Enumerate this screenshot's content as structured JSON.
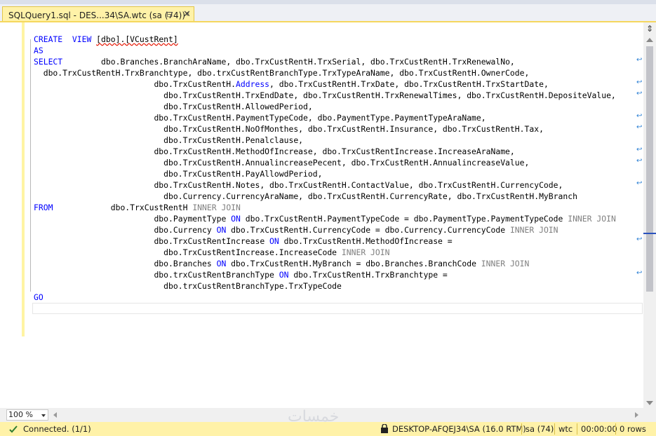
{
  "tab": {
    "title": "SQLQuery1.sql - DES...34\\SA.wtc (sa (74))*",
    "pin_icon": "pin-icon",
    "close_icon": "close-icon"
  },
  "editor": {
    "lines": [
      [
        "CREATE",
        "  VIEW ",
        "[dbo].[VCustRent]"
      ],
      [
        "AS"
      ],
      [
        "SELECT",
        "        dbo.Branches.BranchAraName, dbo.TrxCustRentH.TrxSerial, dbo.TrxCustRentH.TrxRenewalNo,"
      ],
      [
        "  dbo.TrxCustRentH.TrxBranchtype, dbo.trxCustRentBranchType.TrxTypeAraName, dbo.TrxCustRentH.OwnerCode,"
      ],
      [
        "                         dbo.TrxCustRentH.",
        "Address",
        ", dbo.TrxCustRentH.TrxDate, dbo.TrxCustRentH.TrxStartDate,"
      ],
      [
        "                           dbo.TrxCustRentH.TrxEndDate, dbo.TrxCustRentH.TrxRenewalTimes, dbo.TrxCustRentH.DepositeValue,"
      ],
      [
        "                           dbo.TrxCustRentH.AllowedPeriod,"
      ],
      [
        "                         dbo.TrxCustRentH.PaymentTypeCode, dbo.PaymentType.PaymentTypeAraName,"
      ],
      [
        "                           dbo.TrxCustRentH.NoOfMonthes, dbo.TrxCustRentH.Insurance, dbo.TrxCustRentH.Tax,"
      ],
      [
        "                           dbo.TrxCustRentH.Penalclause,"
      ],
      [
        "                         dbo.TrxCustRentH.MethodOfIncrease, dbo.TrxCustRentIncrease.IncreaseAraName,"
      ],
      [
        "                           dbo.TrxCustRentH.AnnualincreasePecent, dbo.TrxCustRentH.AnnualincreaseValue,"
      ],
      [
        "                           dbo.TrxCustRentH.PayAllowdPeriod,"
      ],
      [
        "                         dbo.TrxCustRentH.Notes, dbo.TrxCustRentH.ContactValue, dbo.TrxCustRentH.CurrencyCode,"
      ],
      [
        "                           dbo.Currency.CurrencyAraName, dbo.TrxCustRentH.CurrencyRate, dbo.TrxCustRentH.MyBranch"
      ],
      [
        "FROM",
        "            dbo.TrxCustRentH ",
        "INNER JOIN"
      ],
      [
        "                         dbo.PaymentType ",
        "ON",
        " dbo.TrxCustRentH.PaymentTypeCode = dbo.PaymentType.PaymentTypeCode ",
        "INNER JOIN"
      ],
      [
        "                         dbo.Currency ",
        "ON",
        " dbo.TrxCustRentH.CurrencyCode = dbo.Currency.CurrencyCode ",
        "INNER JOIN"
      ],
      [
        "                         dbo.TrxCustRentIncrease ",
        "ON",
        " dbo.TrxCustRentH.MethodOfIncrease ="
      ],
      [
        "                           dbo.TrxCustRentIncrease.IncreaseCode ",
        "INNER JOIN"
      ],
      [
        "                         dbo.Branches ",
        "ON",
        " dbo.TrxCustRentH.MyBranch = dbo.Branches.BranchCode ",
        "INNER JOIN"
      ],
      [
        "                         dbo.trxCustRentBranchType ",
        "ON",
        " dbo.TrxCustRentH.TrxBranchtype ="
      ],
      [
        "                           dbo.trxCustRentBranchType.TrxTypeCode"
      ],
      [
        "GO"
      ]
    ],
    "wrap_icon": "word-wrap-icon"
  },
  "zoom": {
    "value": "100 %"
  },
  "status": {
    "connection": "Connected. (1/1)",
    "server": "DESKTOP-AFQEJ34\\SA (16.0 RTM)",
    "user": "sa (74)",
    "database": "wtc",
    "elapsed": "00:00:00",
    "rows": "0 rows",
    "accent": "#fff2a8"
  },
  "watermark": "خمسات"
}
